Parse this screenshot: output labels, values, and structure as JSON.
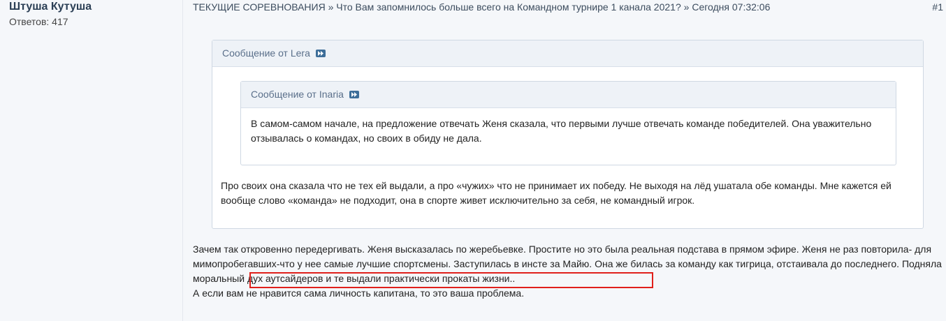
{
  "author": {
    "name": "Штуша Кутуша",
    "replies_label": "Ответов: 417"
  },
  "post": {
    "forum": "ТЕКУЩИЕ СОРЕВНОВАНИЯ",
    "separator": "»",
    "topic": "Что Вам запомнилось больше всего на Командном турнире 1 канала 2021?",
    "separator2": "»",
    "date": "Сегодня 07:32:06",
    "number": "#1"
  },
  "quote_outer": {
    "header": "Сообщение от Lera",
    "text": "Про своих она сказала что не тех ей выдали, а про «чужих» что не принимает их победу. Не выходя на лёд ушатала обе команды. Мне кажется ей вообще слово «команда» не подходит, она в спорте живет исключительно за себя, не командный игрок."
  },
  "quote_inner": {
    "header": "Сообщение от Inaria",
    "text": "В самом-самом начале, на предложение отвечать Женя сказала, что первыми лучше отвечать команде победителей. Она уважительно отзывалась о командах, но своих в обиду не дала."
  },
  "message": {
    "line1": "Зачем так откровенно передергивать. Женя высказалась по жеребьевке. Простите но это была реальная подстава в прямом эфире. Женя не раз повторила- для мимопробегавших-что у нее самые лучшие спортсмены. Заступилась в инсте за Майю. Она же билась за команду как тигрица, отстаивала до последнего.",
    "highlighted": " Подняла моральный дух аутсайдеров и те выдали практически прокаты жизни..",
    "line2": "А если вам не нравится сама личность капитана, то это ваша проблема."
  },
  "colors": {
    "highlight_border": "#e0201b",
    "link": "#3c4c5e"
  }
}
